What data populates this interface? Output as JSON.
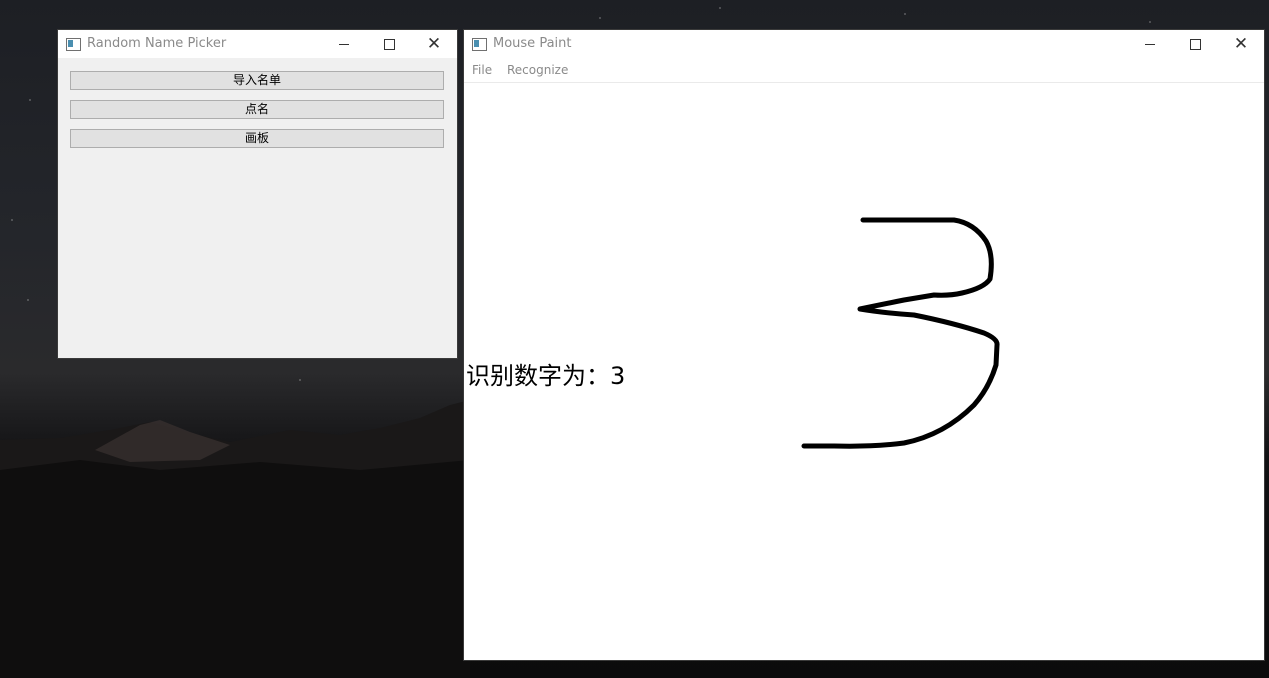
{
  "picker_window": {
    "title": "Random Name Picker",
    "buttons": [
      "导入名单",
      "点名",
      "画板"
    ]
  },
  "paint_window": {
    "title": "Mouse Paint",
    "menu": [
      "File",
      "Recognize"
    ],
    "result_label": "识别数字为：3"
  },
  "colors": {
    "stroke": "#000000",
    "window_bg": "#f0f0f0",
    "canvas_bg": "#ffffff"
  }
}
